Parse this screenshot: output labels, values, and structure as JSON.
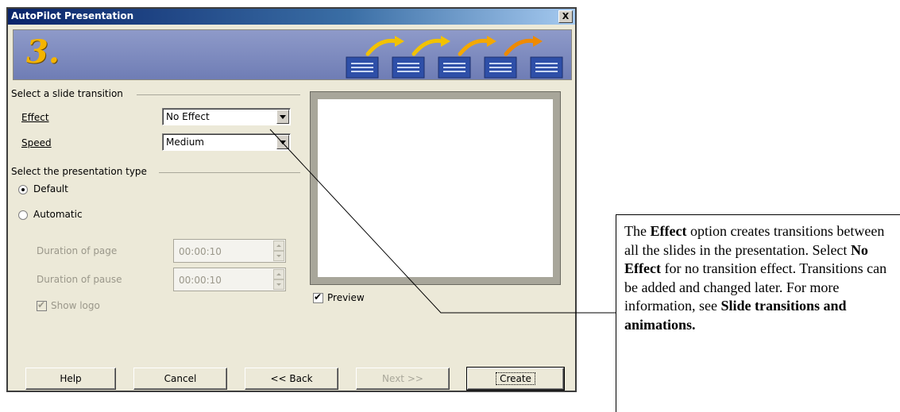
{
  "window": {
    "title": "AutoPilot Presentation",
    "close_label": "X"
  },
  "banner": {
    "step": "3."
  },
  "transition": {
    "group_label": "Select a slide transition",
    "effect_label": "Effect",
    "effect_value": "No Effect",
    "speed_label": "Speed",
    "speed_value": "Medium"
  },
  "presentation_type": {
    "group_label": "Select the presentation type",
    "default_label": "Default",
    "automatic_label": "Automatic",
    "duration_page_label": "Duration of page",
    "duration_page_value": "00:00:10",
    "duration_pause_label": "Duration of pause",
    "duration_pause_value": "00:00:10",
    "show_logo_label": "Show logo",
    "selected": "Default",
    "show_logo_checked": true
  },
  "preview": {
    "label": "Preview",
    "checked": true
  },
  "buttons": {
    "help": "Help",
    "cancel": "Cancel",
    "back": "<< Back",
    "next": "Next >>",
    "create": "Create"
  },
  "callout": {
    "t1": "The ",
    "b1": "Effect",
    "t2": " option creates transitions between all the slides in the presentation. Select ",
    "b2": "No Effect",
    "t3": " for no transition effect. Transitions can be added and changed later. For more information, see ",
    "b3": "Slide transitions and animations."
  },
  "colors": {
    "title_bar": "#0a246a",
    "banner": "#7481bb",
    "step_number": "#f4b400",
    "arrow": "#f2c200"
  }
}
